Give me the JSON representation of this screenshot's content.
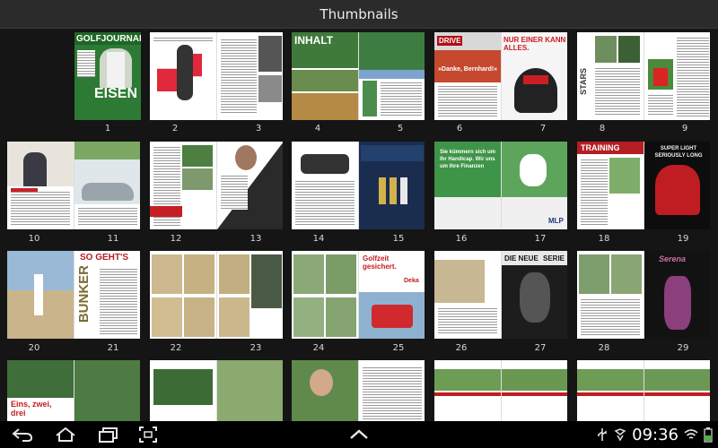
{
  "header": {
    "title": "Thumbnails"
  },
  "thumbnails": {
    "page_numbers": [
      "1",
      "2",
      "3",
      "4",
      "5",
      "6",
      "7",
      "8",
      "9",
      "10",
      "11",
      "12",
      "13",
      "14",
      "15",
      "16",
      "17",
      "18",
      "19",
      "20",
      "21",
      "22",
      "23",
      "24",
      "25",
      "26",
      "27",
      "28",
      "29"
    ],
    "text": {
      "golfjournal": "GOLFJOURNAL",
      "eisen": "EISEN",
      "inhalt": "INHALT",
      "drive": "DRIVE",
      "nur_einer": "NUR EINER KANN ALLES.",
      "danke": "»Danke, Bernhard!«",
      "stars": "STARS",
      "pro_shop_head": "Sie kümmern sich um Ihr Handicap. Wir uns um Ihre Finanzen",
      "mlp": "MLP",
      "training": "TRAINING",
      "super_light": "SUPER LIGHT SERIOUSLY LONG",
      "so_gehts": "SO GEHT'S",
      "bunker": "BUNKER",
      "golfzeit": "Golfzeit gesichert.",
      "deka": "Deka",
      "die_neue": "DIE NEUE",
      "serie": "SERIE",
      "serena": "Serena",
      "eins_zwei_drei": "Eins, zwei, drei"
    }
  },
  "navbar": {
    "back_icon": "back-icon",
    "home_icon": "home-icon",
    "recent_icon": "recent-apps-icon",
    "screenshot_icon": "screenshot-icon",
    "up_icon": "chevron-up-icon",
    "usb_icon": "usb-icon",
    "wifi_icon": "wifi-icon",
    "time": "09:36"
  }
}
